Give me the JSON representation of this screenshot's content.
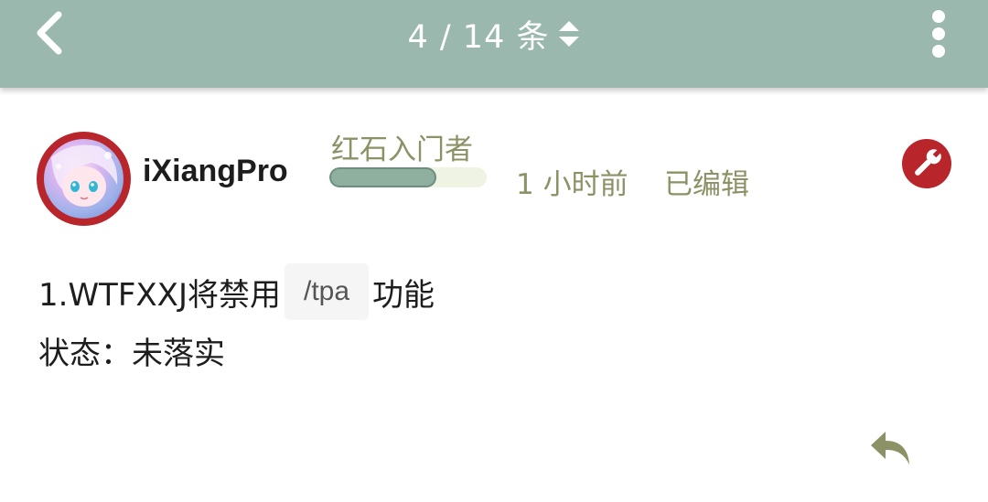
{
  "header": {
    "position_label": "4 / 14 条",
    "back_icon": "chevron-left-icon",
    "sort_icon": "sort-updown-icon",
    "more_icon": "more-vertical-icon",
    "bar_color": "#9ab8ae"
  },
  "post": {
    "username": "iXiangPro",
    "rank_title": "红石入门者",
    "rank_progress": 0.68,
    "time": "1 小时前",
    "edited_label": "已编辑",
    "admin_icon": "wrench-icon",
    "accent_color": "#b8252a",
    "meta_color": "#8c9166",
    "content": {
      "line1_prefix": "1.WTFXXJ将禁用",
      "line1_code": "/tpa",
      "line1_suffix": "功能",
      "line2": "状态：未落实"
    },
    "reply_icon": "reply-icon"
  }
}
